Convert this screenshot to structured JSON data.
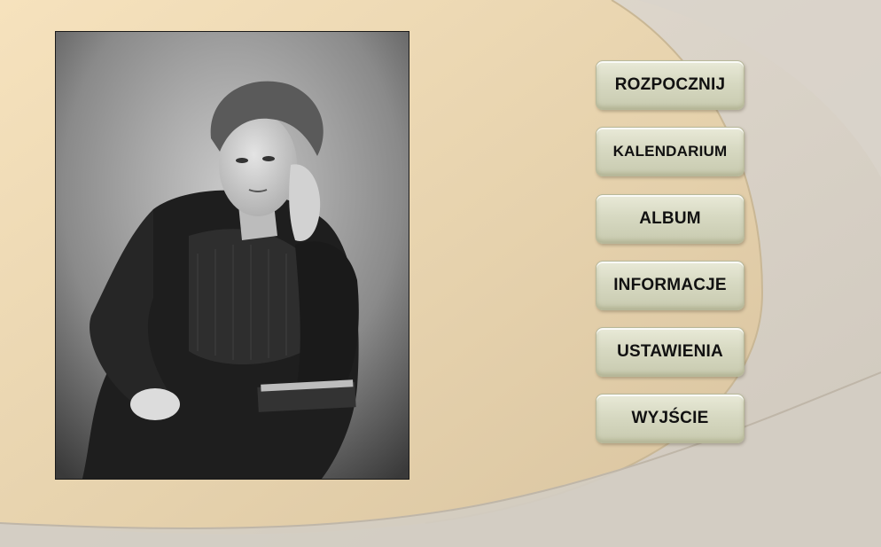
{
  "photo": {
    "subject": "portrait-photo"
  },
  "menu": {
    "items": [
      {
        "label": "ROZPOCZNIJ"
      },
      {
        "label": "KALENDARIUM"
      },
      {
        "label": "ALBUM"
      },
      {
        "label": "INFORMACJE"
      },
      {
        "label": "USTAWIENIA"
      },
      {
        "label": "WYJŚCIE"
      }
    ]
  },
  "colors": {
    "background_tan": "#e9d8b6",
    "background_gray": "#d8d2c8",
    "button_face": "#dcdcc6",
    "button_text": "#111111"
  }
}
